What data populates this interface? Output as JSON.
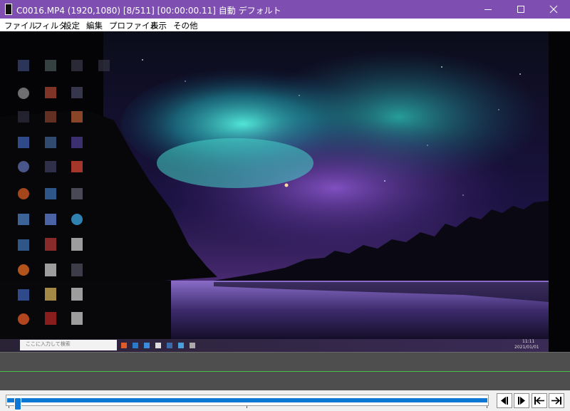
{
  "window": {
    "title": "C0016.MP4 (1920,1080)  [8/511] [00:00:00.11]  自動  デフォルト",
    "accent_color": "#7e4fb0",
    "controls": [
      "minimize-icon",
      "maximize-icon",
      "close-icon"
    ]
  },
  "menu": {
    "items": [
      "ファイル",
      "フィルタ",
      "設定",
      "編集",
      "プロファイル",
      "表示",
      "その他"
    ]
  },
  "video": {
    "taskbar_search_placeholder": "ここに入力して検索",
    "clock_time": "11:11",
    "clock_date": "2021/01/01"
  },
  "seekbar": {
    "position_fraction": 0.016,
    "fill_color": "#0a78d4"
  },
  "transport": {
    "buttons": [
      "prev-frame-icon",
      "next-frame-icon",
      "go-start-icon",
      "go-end-icon"
    ]
  }
}
